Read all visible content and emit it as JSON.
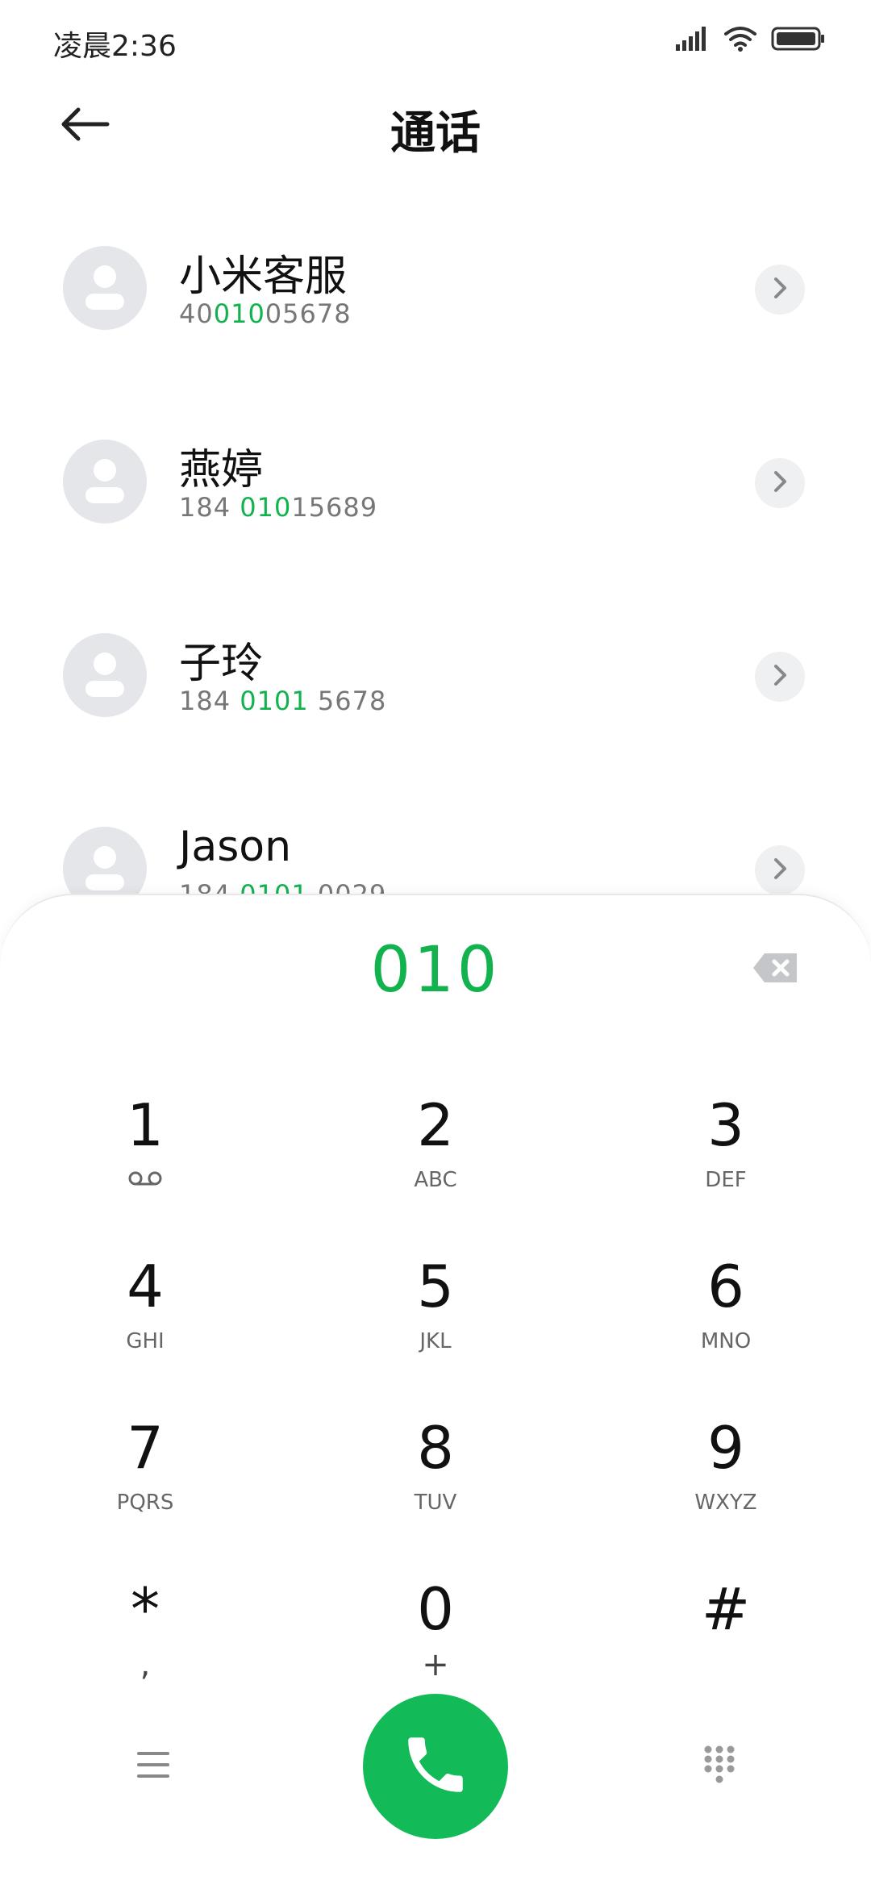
{
  "status_bar": {
    "time": "凌晨2:36",
    "icons": [
      "signal-icon",
      "wifi-icon",
      "battery-icon"
    ]
  },
  "header": {
    "title": "通话",
    "back_icon": "back-arrow-icon"
  },
  "contacts": [
    {
      "name": "小米客服",
      "number_parts": [
        "40",
        "010",
        "05678"
      ]
    },
    {
      "name": "燕婷",
      "number_parts": [
        "184 ",
        "010",
        "15689"
      ]
    },
    {
      "name": "子玲",
      "number_parts": [
        "184 ",
        "0101",
        " 5678"
      ]
    },
    {
      "name": "Jason",
      "number_parts": [
        "184 ",
        "0101",
        " 0029"
      ]
    }
  ],
  "dialer": {
    "input": "010",
    "keys": [
      {
        "digit": "1",
        "sub": "",
        "sub_icon": "voicemail-icon"
      },
      {
        "digit": "2",
        "sub": "ABC"
      },
      {
        "digit": "3",
        "sub": "DEF"
      },
      {
        "digit": "4",
        "sub": "GHI"
      },
      {
        "digit": "5",
        "sub": "JKL"
      },
      {
        "digit": "6",
        "sub": "MNO"
      },
      {
        "digit": "7",
        "sub": "PQRS"
      },
      {
        "digit": "8",
        "sub": "TUV"
      },
      {
        "digit": "9",
        "sub": "WXYZ"
      },
      {
        "digit": "*",
        "sub": ","
      },
      {
        "digit": "0",
        "sub": "+"
      },
      {
        "digit": "#",
        "sub": ""
      }
    ]
  },
  "colors": {
    "accent": "#12b24f",
    "call_button": "#12bb58",
    "avatar_bg": "#e4e6ea"
  }
}
